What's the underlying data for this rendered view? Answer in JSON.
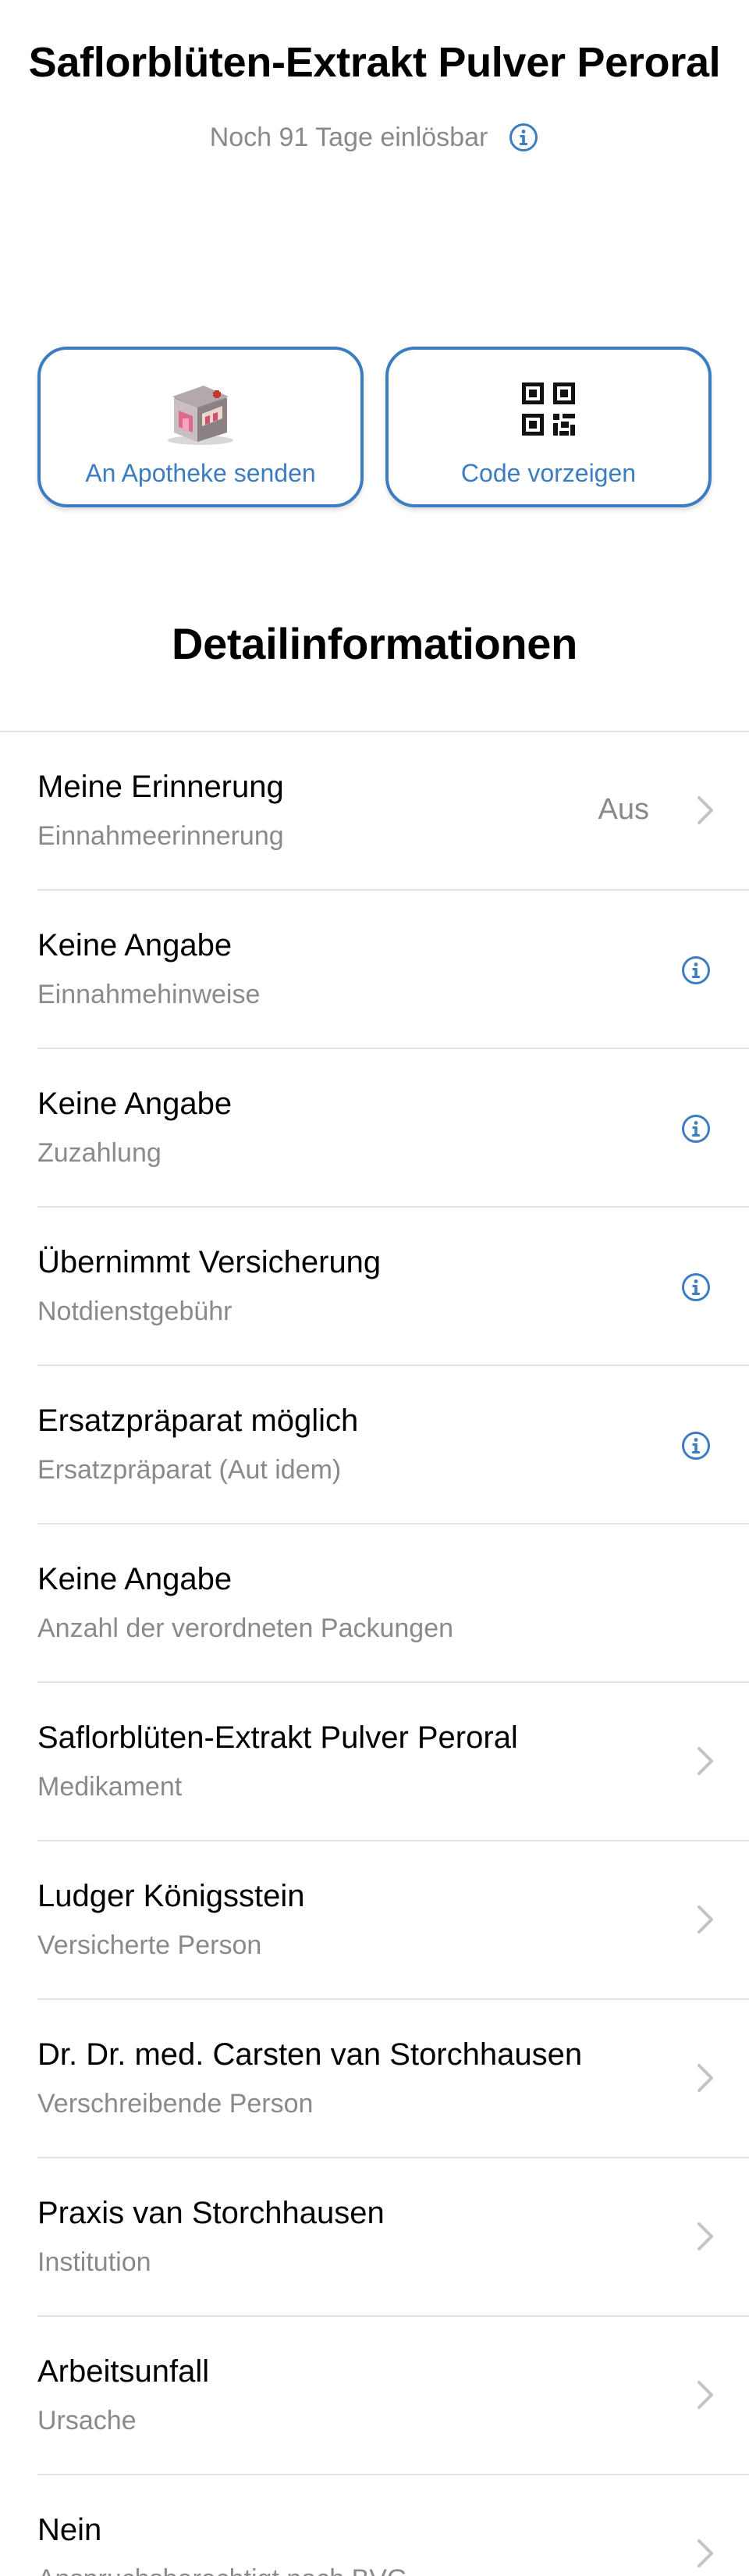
{
  "header": {
    "title": "Saflorblüten-Extrakt Pulver Peroral",
    "subtitle": "Noch 91 Tage einlösbar"
  },
  "actions": {
    "send": {
      "label": "An Apotheke senden",
      "icon": "pharmacy-icon"
    },
    "code": {
      "label": "Code vorzeigen",
      "icon": "qr-code-icon"
    }
  },
  "colors": {
    "accent": "#3c7dc2",
    "secondary_text": "#8a8a8e",
    "separator": "#e2e2e5"
  },
  "section": {
    "title": "Detailinformationen"
  },
  "details": [
    {
      "title": "Meine Erinnerung",
      "subtitle": "Einnahmeerinnerung",
      "value": "Aus",
      "accessory": "chevron"
    },
    {
      "title": "Keine Angabe",
      "subtitle": "Einnahmehinweise",
      "value": "",
      "accessory": "info"
    },
    {
      "title": "Keine Angabe",
      "subtitle": "Zuzahlung",
      "value": "",
      "accessory": "info"
    },
    {
      "title": "Übernimmt Versicherung",
      "subtitle": "Notdienstgebühr",
      "value": "",
      "accessory": "info"
    },
    {
      "title": "Ersatzpräparat möglich",
      "subtitle": "Ersatzpräparat (Aut idem)",
      "value": "",
      "accessory": "info"
    },
    {
      "title": "Keine Angabe",
      "subtitle": "Anzahl der verordneten Packungen",
      "value": "",
      "accessory": "none"
    },
    {
      "title": "Saflorblüten-Extrakt Pulver Peroral",
      "subtitle": "Medikament",
      "value": "",
      "accessory": "chevron"
    },
    {
      "title": "Ludger Königsstein",
      "subtitle": "Versicherte Person",
      "value": "",
      "accessory": "chevron"
    },
    {
      "title": "Dr. Dr. med. Carsten van Storchhausen",
      "subtitle": "Verschreibende Person",
      "value": "",
      "accessory": "chevron"
    },
    {
      "title": "Praxis van Storchhausen",
      "subtitle": "Institution",
      "value": "",
      "accessory": "chevron"
    },
    {
      "title": "Arbeitsunfall",
      "subtitle": "Ursache",
      "value": "",
      "accessory": "chevron"
    },
    {
      "title": "Nein",
      "subtitle": "Anspruchsberechtigt nach BVG",
      "value": "",
      "accessory": "chevron"
    }
  ]
}
